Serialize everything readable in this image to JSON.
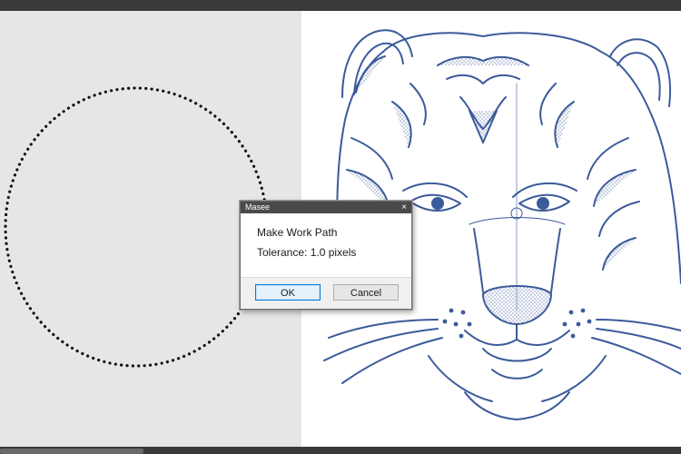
{
  "dialog": {
    "window_title": "Maseе",
    "close_glyph": "×",
    "heading": "Make Work Path",
    "tolerance_text": "Tolerance: 1.0 pixels",
    "ok_label": "OK",
    "cancel_label": "Cancel"
  },
  "canvas": {
    "selection_shape": "circle",
    "selection_style": "marching-ants-dotted",
    "artwork": "tiger-head-line-art-icon",
    "artwork_color": "#3b5b9a",
    "left_background": "#e6e6e6",
    "right_background": "#ffffff"
  },
  "colors": {
    "chrome": "#3a3a3a",
    "dialog_titlebar": "#4a4a4a",
    "ok_border": "#0078d7"
  }
}
